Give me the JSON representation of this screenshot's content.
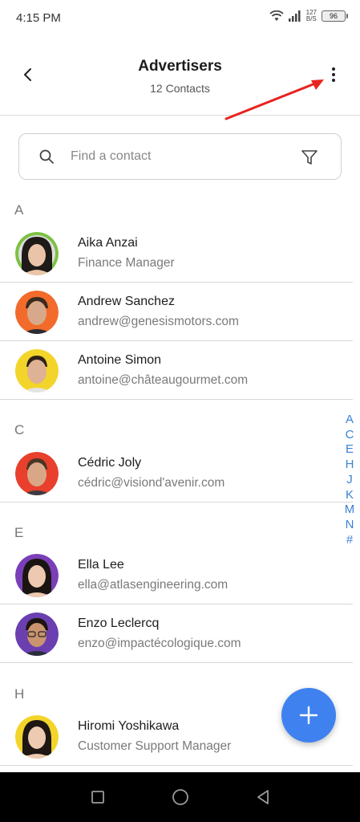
{
  "status_bar": {
    "time": "4:15 PM",
    "net_speed_top": "127",
    "net_speed_bottom": "B/S",
    "battery": "96"
  },
  "header": {
    "title": "Advertisers",
    "subtitle": "12 Contacts"
  },
  "search": {
    "placeholder": "Find a contact"
  },
  "sections": [
    {
      "letter": "A",
      "contacts": [
        {
          "name": "Aika Anzai",
          "detail": "Finance Manager",
          "ring": "#7cc142"
        },
        {
          "name": "Andrew Sanchez",
          "detail": "andrew@genesismotors.com",
          "ring": "#f26b2a"
        },
        {
          "name": "Antoine Simon",
          "detail": "antoine@châteaugourmet.com",
          "ring": "#f3d42a"
        }
      ]
    },
    {
      "letter": "C",
      "contacts": [
        {
          "name": "Cédric Joly",
          "detail": "cédric@visiond'avenir.com",
          "ring": "#e8402c"
        }
      ]
    },
    {
      "letter": "E",
      "contacts": [
        {
          "name": "Ella Lee",
          "detail": "ella@atlasengineering.com",
          "ring": "#7a3fb8"
        },
        {
          "name": "Enzo Leclercq",
          "detail": "enzo@impactécologique.com",
          "ring": "#6b3fb0"
        }
      ]
    },
    {
      "letter": "H",
      "contacts": [
        {
          "name": "Hiromi Yoshikawa",
          "detail": "Customer Support Manager",
          "ring": "#f3d42a"
        }
      ]
    }
  ],
  "index_letters": [
    "A",
    "C",
    "E",
    "H",
    "J",
    "K",
    "M",
    "N",
    "#"
  ],
  "colors": {
    "accent": "#3f82ef",
    "index": "#3b82d6",
    "annotation_arrow": "#e8231f"
  },
  "icons": {
    "back": "chevron-left-icon",
    "more": "more-vertical-icon",
    "search": "search-icon",
    "filter": "filter-icon",
    "fab": "plus-icon"
  }
}
